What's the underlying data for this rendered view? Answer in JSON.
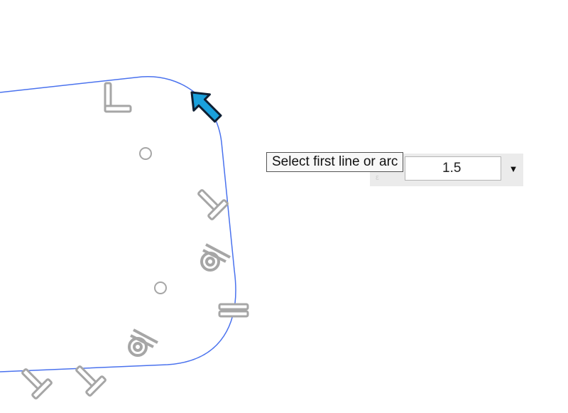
{
  "tooltip": {
    "text": "Select first line or arc"
  },
  "dimension_input": {
    "value": "1.5",
    "dropdown_icon": "chevron-down-icon"
  },
  "colors": {
    "sketch_profile": "#4a72ee",
    "constraint_glyph": "#a6a6a6",
    "cursor_fill": "#1aa0dc",
    "cursor_outline": "#0f1f33"
  }
}
